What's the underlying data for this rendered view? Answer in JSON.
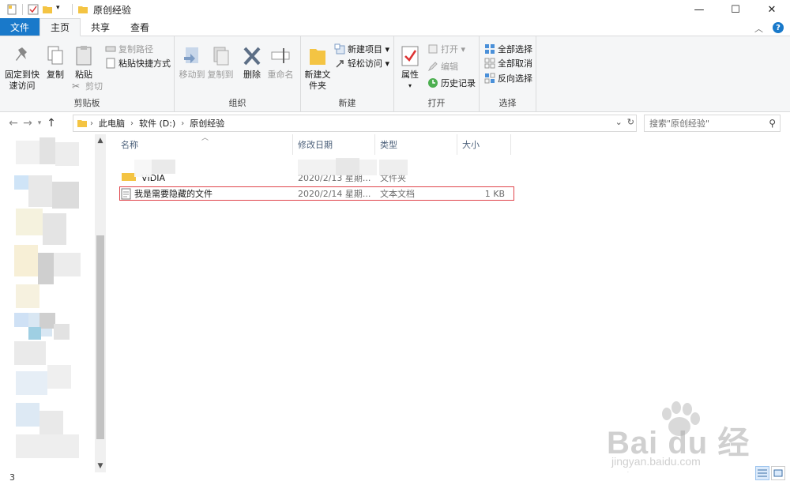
{
  "window": {
    "title": "原创经验",
    "minimize": "—",
    "maximize": "☐",
    "close": "✕"
  },
  "tabs": {
    "file": "文件",
    "home": "主页",
    "share": "共享",
    "view": "查看"
  },
  "ribbon": {
    "clipboard": {
      "pin": "固定到快速访问",
      "copy": "复制",
      "paste": "粘贴",
      "copy_path": "复制路径",
      "paste_shortcut": "粘贴快捷方式",
      "cut": "剪切",
      "label": "剪贴板"
    },
    "organize": {
      "move_to": "移动到",
      "copy_to": "复制到",
      "delete": "删除",
      "rename": "重命名",
      "label": "组织"
    },
    "new": {
      "new_folder": "新建文件夹",
      "new_item": "新建项目 ▾",
      "easy_access": "轻松访问 ▾",
      "label": "新建"
    },
    "open": {
      "properties": "属性",
      "open": "打开 ▾",
      "edit": "编辑",
      "history": "历史记录",
      "label": "打开"
    },
    "select": {
      "select_all": "全部选择",
      "select_none": "全部取消",
      "invert": "反向选择",
      "label": "选择"
    }
  },
  "address": {
    "crumbs": [
      "此电脑",
      "软件 (D:)",
      "原创经验"
    ]
  },
  "search": {
    "placeholder": "搜索\"原创经验\""
  },
  "columns": {
    "name": "名称",
    "date": "修改日期",
    "type": "类型",
    "size": "大小"
  },
  "files": [
    {
      "name": "VIDIA",
      "date": "2020/2/13 星期...",
      "type": "文件夹",
      "size": ""
    },
    {
      "name": "我是需要隐藏的文件",
      "date": "2020/2/14 星期...",
      "type": "文本文档",
      "size": "1 KB"
    }
  ],
  "status": {
    "count": "3"
  },
  "watermark": {
    "brand": "Bai du 经验",
    "url": "jingyan.baidu.com"
  },
  "colors": {
    "file_tab": "#1979ca",
    "highlight": "#e0444b",
    "folder": "#f4c443"
  }
}
